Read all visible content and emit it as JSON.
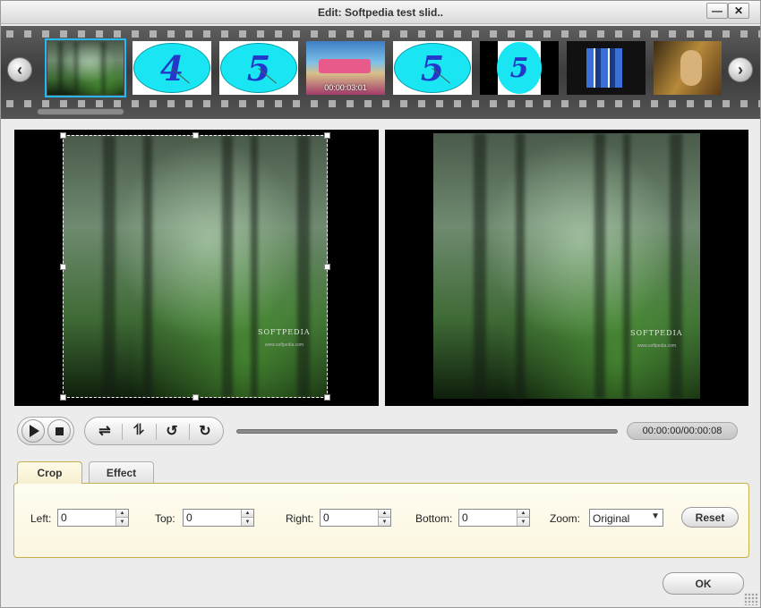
{
  "window": {
    "title": "Edit: Softpedia test slid..",
    "minimize_glyph": "—",
    "close_glyph": "✕"
  },
  "filmstrip": {
    "prev_icon": "‹",
    "next_icon": "›",
    "thumbnails": [
      {
        "kind": "photo",
        "selected": true
      },
      {
        "kind": "ellipse",
        "label": "4"
      },
      {
        "kind": "ellipse",
        "label": "5"
      },
      {
        "kind": "video",
        "time": "00:00:03:01"
      },
      {
        "kind": "ellipse",
        "label": "5"
      },
      {
        "kind": "narrow-ellipse",
        "label": "5"
      },
      {
        "kind": "transition"
      },
      {
        "kind": "photo-warm"
      }
    ]
  },
  "preview": {
    "watermark": "SOFTPEDIA",
    "watermark_sub": "www.softpedia.com"
  },
  "controls": {
    "time": "00:00:00/00:00:08",
    "flip_h_icon": "⇌",
    "flip_v_icon": "⥮",
    "rotate_left_icon": "↺",
    "rotate_right_icon": "↻"
  },
  "tabs": {
    "crop": "Crop",
    "effect": "Effect"
  },
  "crop": {
    "left_label": "Left:",
    "left_value": "0",
    "top_label": "Top:",
    "top_value": "0",
    "right_label": "Right:",
    "right_value": "0",
    "bottom_label": "Bottom:",
    "bottom_value": "0",
    "zoom_label": "Zoom:",
    "zoom_value": "Original",
    "reset_label": "Reset"
  },
  "footer": {
    "ok_label": "OK"
  }
}
